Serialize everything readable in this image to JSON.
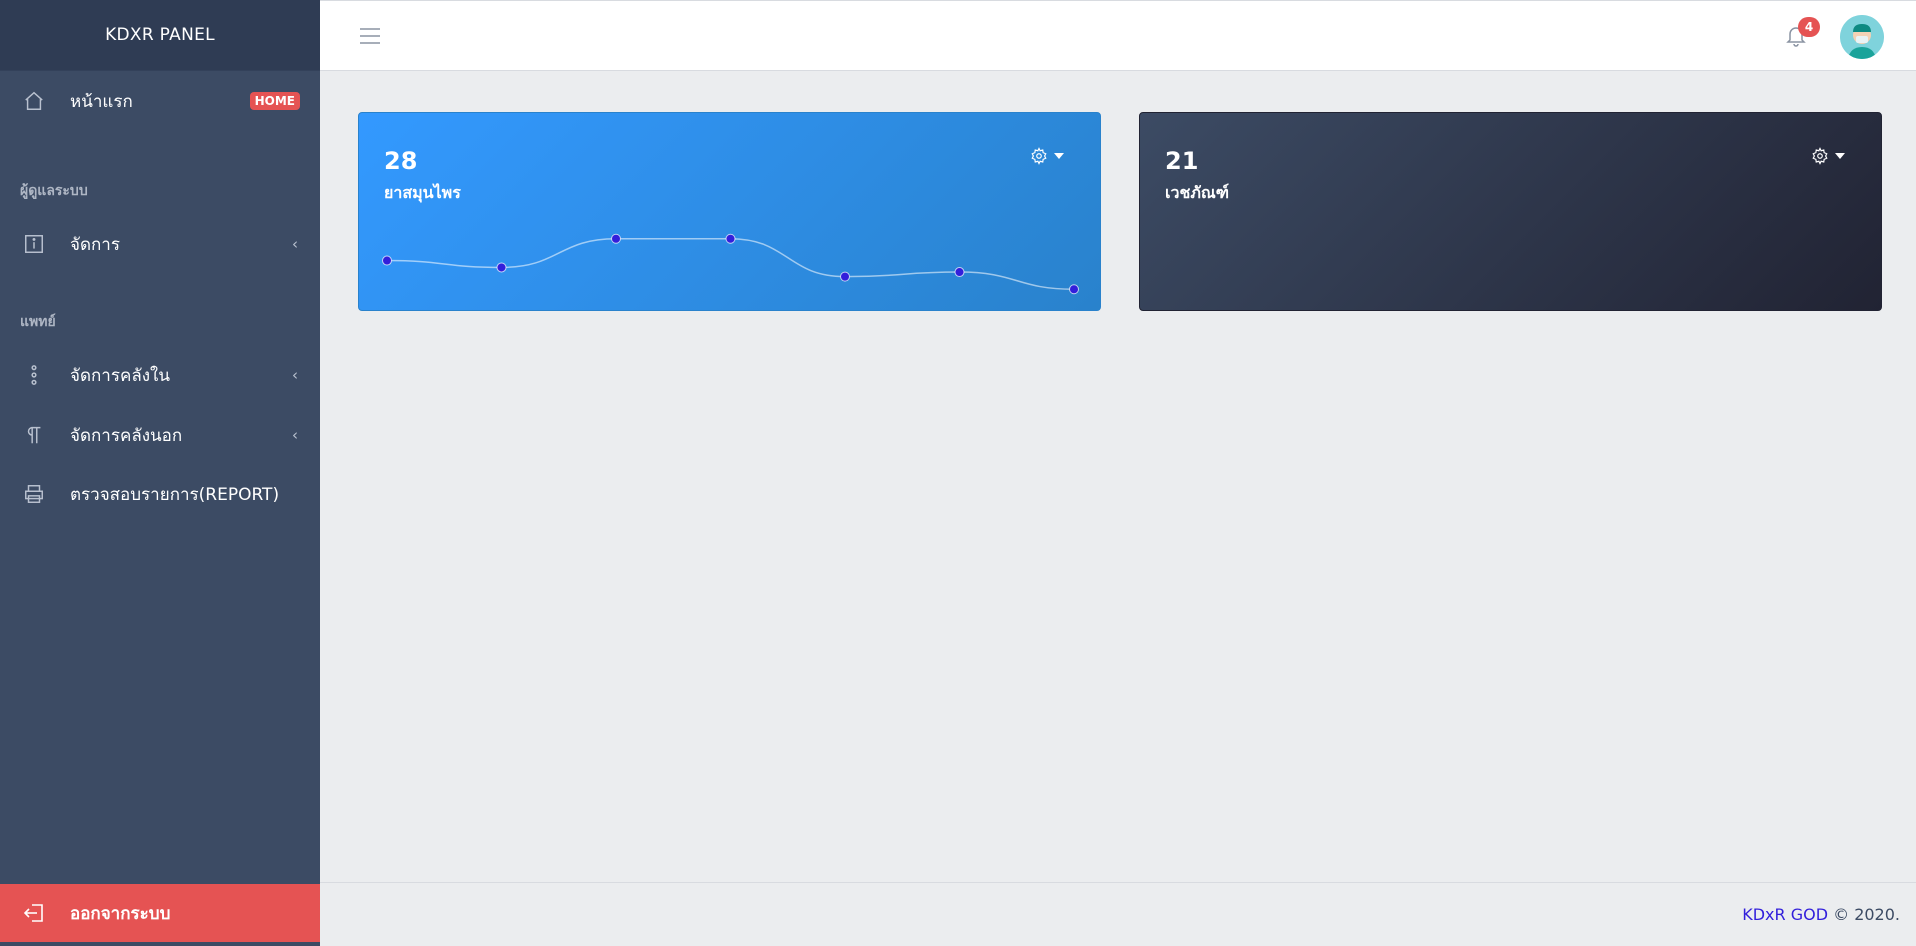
{
  "sidebar": {
    "brand": "KDXR PANEL",
    "home": {
      "label": "หน้าแรก",
      "badge": "HOME",
      "icon": "home-icon"
    },
    "section_admin": "ผู้ดูแลระบบ",
    "manage": {
      "label": "จัดการ",
      "icon": "info-icon"
    },
    "section_doctor": "แพทย์",
    "inner_stock": {
      "label": "จัดการคลังใน",
      "icon": "options-icon"
    },
    "outer_stock": {
      "label": "จัดการคลังนอก",
      "icon": "paragraph-icon"
    },
    "report": {
      "label": "ตรวจสอบรายการ(REPORT)",
      "icon": "print-icon"
    },
    "logout": {
      "label": "ออกจากระบบ",
      "icon": "logout-icon"
    }
  },
  "header": {
    "notifications": "4"
  },
  "cards": [
    {
      "value": "28",
      "title": "ยาสมุนไพร",
      "color": "#3399ff"
    },
    {
      "value": "21",
      "title": "เวชภัณฑ์",
      "color": "#3c4b64"
    }
  ],
  "chart_data": {
    "type": "line",
    "series": [
      {
        "values": [
          65,
          59,
          84,
          84,
          51,
          55,
          40
        ]
      }
    ]
  },
  "footer": {
    "link": "KDxR GOD",
    "text": "© 2020."
  }
}
